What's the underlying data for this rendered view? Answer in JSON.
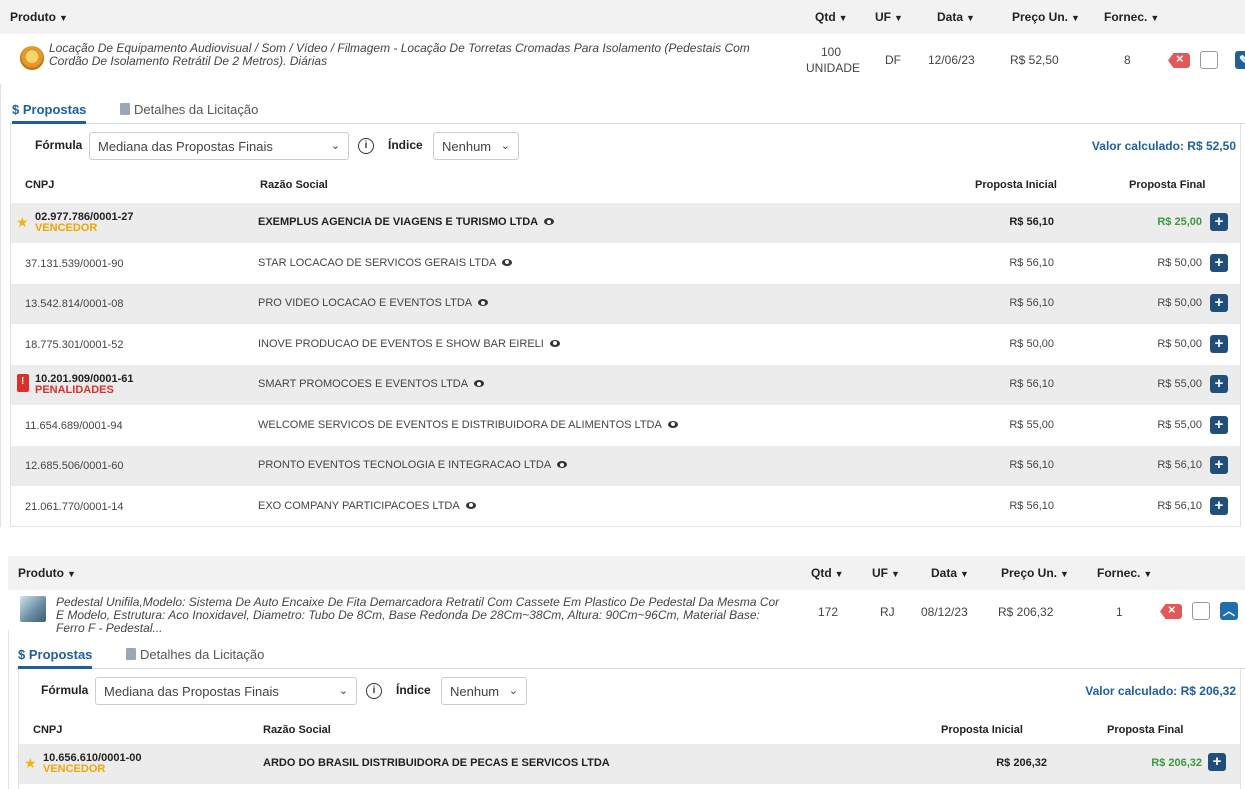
{
  "headers": {
    "produto": "Produto",
    "qtd": "Qtd",
    "uf": "UF",
    "data": "Data",
    "preco": "Preço Un.",
    "fornec": "Fornec."
  },
  "tabs": {
    "propostas": "$ Propostas",
    "detalhes": "Detalhes da Licitação"
  },
  "formula": {
    "label": "Fórmula",
    "value": "Mediana das Propostas Finais",
    "indice_label": "Índice",
    "indice_value": "Nenhum"
  },
  "table_headers": {
    "cnpj": "CNPJ",
    "razao": "Razão Social",
    "inicial": "Proposta Inicial",
    "final": "Proposta Final"
  },
  "panel1": {
    "desc": "Locação De Equipamento Audiovisual / Som / Vídeo / Filmagem - Locação De Torretas Cromadas Para Isolamento (Pedestais Com Cordão De Isolamento Retrátil De 2 Metros). Diárias",
    "qtd_value": "100",
    "qtd_unit": "UNIDADE",
    "uf": "DF",
    "data": "12/06/23",
    "preco": "R$ 52,50",
    "fornec": "8",
    "valor_calc": "Valor calculado: R$ 52,50",
    "rows": [
      {
        "cnpj": "02.977.786/0001-27",
        "tag": "VENCEDOR",
        "razao": "EXEMPLUS AGENCIA DE VIAGENS E TURISMO LTDA",
        "pi": "R$ 56,10",
        "pf": "R$ 25,00"
      },
      {
        "cnpj": "37.131.539/0001-90",
        "razao": "STAR LOCACAO DE SERVICOS GERAIS LTDA",
        "pi": "R$ 56,10",
        "pf": "R$ 50,00"
      },
      {
        "cnpj": "13.542.814/0001-08",
        "razao": "PRO VIDEO LOCACAO E EVENTOS LTDA",
        "pi": "R$ 56,10",
        "pf": "R$ 50,00"
      },
      {
        "cnpj": "18.775.301/0001-52",
        "razao": "INOVE PRODUCAO DE EVENTOS E SHOW BAR EIRELI",
        "pi": "R$ 50,00",
        "pf": "R$ 50,00"
      },
      {
        "cnpj": "10.201.909/0001-61",
        "tag": "PENALIDADES",
        "razao": "SMART PROMOCOES E EVENTOS LTDA",
        "pi": "R$ 56,10",
        "pf": "R$ 55,00"
      },
      {
        "cnpj": "11.654.689/0001-94",
        "razao": "WELCOME SERVICOS DE EVENTOS E DISTRIBUIDORA DE ALIMENTOS LTDA",
        "pi": "R$ 55,00",
        "pf": "R$ 55,00"
      },
      {
        "cnpj": "12.685.506/0001-60",
        "razao": "PRONTO EVENTOS TECNOLOGIA E INTEGRACAO LTDA",
        "pi": "R$ 56,10",
        "pf": "R$ 56,10"
      },
      {
        "cnpj": "21.061.770/0001-14",
        "razao": "EXO COMPANY PARTICIPACOES LTDA",
        "pi": "R$ 56,10",
        "pf": "R$ 56,10"
      }
    ]
  },
  "panel2": {
    "desc": "Pedestal Unifila,Modelo: Sistema De Auto Encaixe De Fita Demarcadora Retratil Com Cassete Em Plastico De Pedestal Da Mesma Cor E Modelo, Estrutura: Aco Inoxidavel, Diametro: Tubo De 8Cm, Base Redonda De 28Cm~38Cm, Altura: 90Cm~96Cm, Material Base: Ferro F - Pedestal...",
    "qtd_value": "172",
    "uf": "RJ",
    "data": "08/12/23",
    "preco": "R$ 206,32",
    "fornec": "1",
    "valor_calc": "Valor calculado: R$ 206,32",
    "rows": [
      {
        "cnpj": "10.656.610/0001-00",
        "tag": "VENCEDOR",
        "razao": "ARDO DO BRASIL DISTRIBUIDORA DE PECAS E SERVICOS LTDA",
        "pi": "R$ 206,32",
        "pf": "R$ 206,32"
      }
    ]
  }
}
